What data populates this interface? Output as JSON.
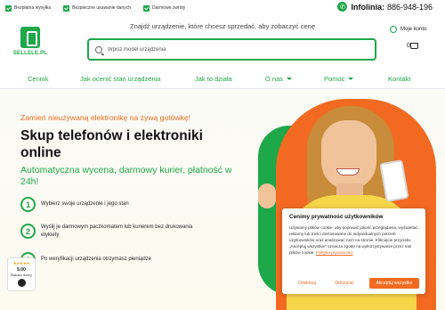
{
  "topbar": {
    "perks": [
      "Bezpłatna wysyłka",
      "Bezpieczne usuwanie danych",
      "Darmowe zwroty"
    ],
    "phone_label": "Infolinia:",
    "phone_number": "886-948-196"
  },
  "header": {
    "logo_text": "SELLELE.PL",
    "tagline": "Znajdź urządzenie, które chcesz sprzedać, aby zobaczyć cenę",
    "search_placeholder": "Wpisz model urządzenia",
    "account_label": "Moje konto",
    "cart_count": "0"
  },
  "nav": {
    "items": [
      {
        "label": "Cennik",
        "has_dropdown": false
      },
      {
        "label": "Jak ocenić stan urządzenia",
        "has_dropdown": false
      },
      {
        "label": "Jak to działa",
        "has_dropdown": false
      },
      {
        "label": "O nas",
        "has_dropdown": true
      },
      {
        "label": "Pomoc",
        "has_dropdown": true
      },
      {
        "label": "Kontakt",
        "has_dropdown": false
      }
    ]
  },
  "hero": {
    "promo": "Zamień nieużywaną elektronikę na żywą gotówkę!",
    "title": "Skup telefonów i elektroniki online",
    "subtitle": "Automatyczna wycena, darmowy kurier, płatność w 24h!",
    "steps": [
      {
        "num": "1",
        "text": "Wybierz swoje urządzenie i jego stan"
      },
      {
        "num": "2",
        "text": "Wyślij je darmowym paczkomatem lub kurierem bez drukowania etykiety"
      },
      {
        "num": "3",
        "text": "Po weryfikacji urządzenia otrzymasz pieniądze"
      }
    ]
  },
  "reviews_badge": {
    "stars": "★★★★★",
    "score": "5.00",
    "label": "Bardzo dobry"
  },
  "cookie": {
    "title": "Cenimy prywatność użytkowników",
    "body": "Używamy plików cookie, aby poprawić jakość przeglądania, wyświetlać reklamy lub treści dostosowane do indywidualnych potrzeb użytkowników oraz analizować ruch na stronie. Kliknięcie przycisku „Akceptuj wszystkie\" oznacza zgodę na wykorzystywanie przez nas plików cookie.",
    "link": "Polityka prywatności",
    "btn_customize": "Dostosuj",
    "btn_reject": "Odrzucać",
    "btn_accept": "Akceptuj wszystko"
  },
  "colors": {
    "brand_green": "#1ea84a",
    "accent_orange": "#f26a21"
  }
}
